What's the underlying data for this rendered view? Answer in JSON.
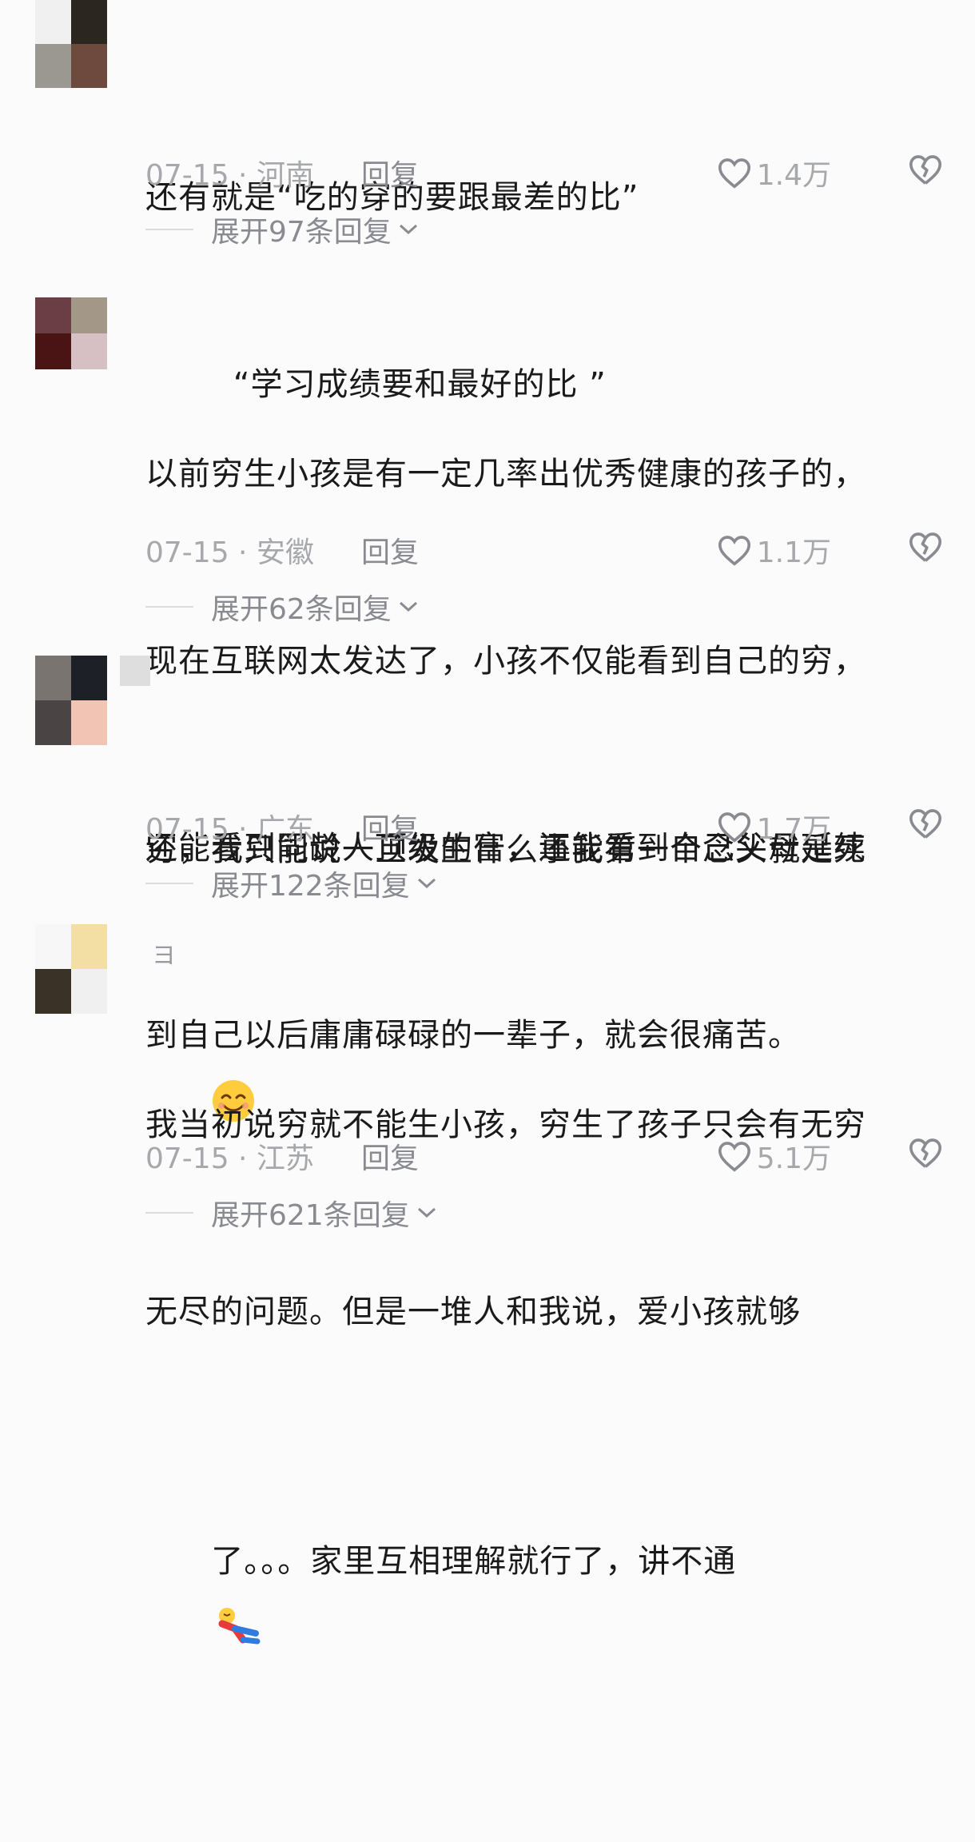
{
  "comments": [
    {
      "text_lines": [
        "还有就是“吃的穿的要跟最差的比”",
        "        “学习成绩要和最好的比 ”"
      ],
      "date": "07-15 · 河南",
      "reply_label": "回复",
      "likes": "1.4万",
      "expand_label": "展开97条回复"
    },
    {
      "text_lines": [
        "以前穷生小孩是有一定几率出优秀健康的孩子的，",
        "现在互联网太发达了，小孩不仅能看到自己的穷，",
        "还能看到同龄人顶级的富，还能看到自己父母延续",
        "到自己以后庸庸碌碌的一辈子，就会很痛苦。"
      ],
      "date": "07-15 · 安徽",
      "reply_label": "回复",
      "likes": "1.1万",
      "expand_label": "展开62条回复"
    },
    {
      "text_lines": [
        "穷，我只能说一旦发生什么事我第一个念头就是死"
      ],
      "emoji": "smiling-face",
      "date": "07-15 · 广东",
      "reply_label": "回复",
      "likes": "1.7万",
      "expand_label": "展开122条回复"
    },
    {
      "username_fragment": "ヨ",
      "text_lines": [
        "我当初说穷就不能生小孩，穷生了孩子只会有无穷",
        "无尽的问题。但是一堆人和我说，爱小孩就够",
        "了。。。家里互相理解就行了，讲不通"
      ],
      "emoji": "lying-down-sticker",
      "date": "07-15 · 江苏",
      "reply_label": "回复",
      "likes": "5.1万",
      "expand_label": "展开621条回复"
    }
  ],
  "colors": {
    "background": "#fbfbfb",
    "text": "#1a1a1a",
    "meta": "#a7a8ac"
  }
}
